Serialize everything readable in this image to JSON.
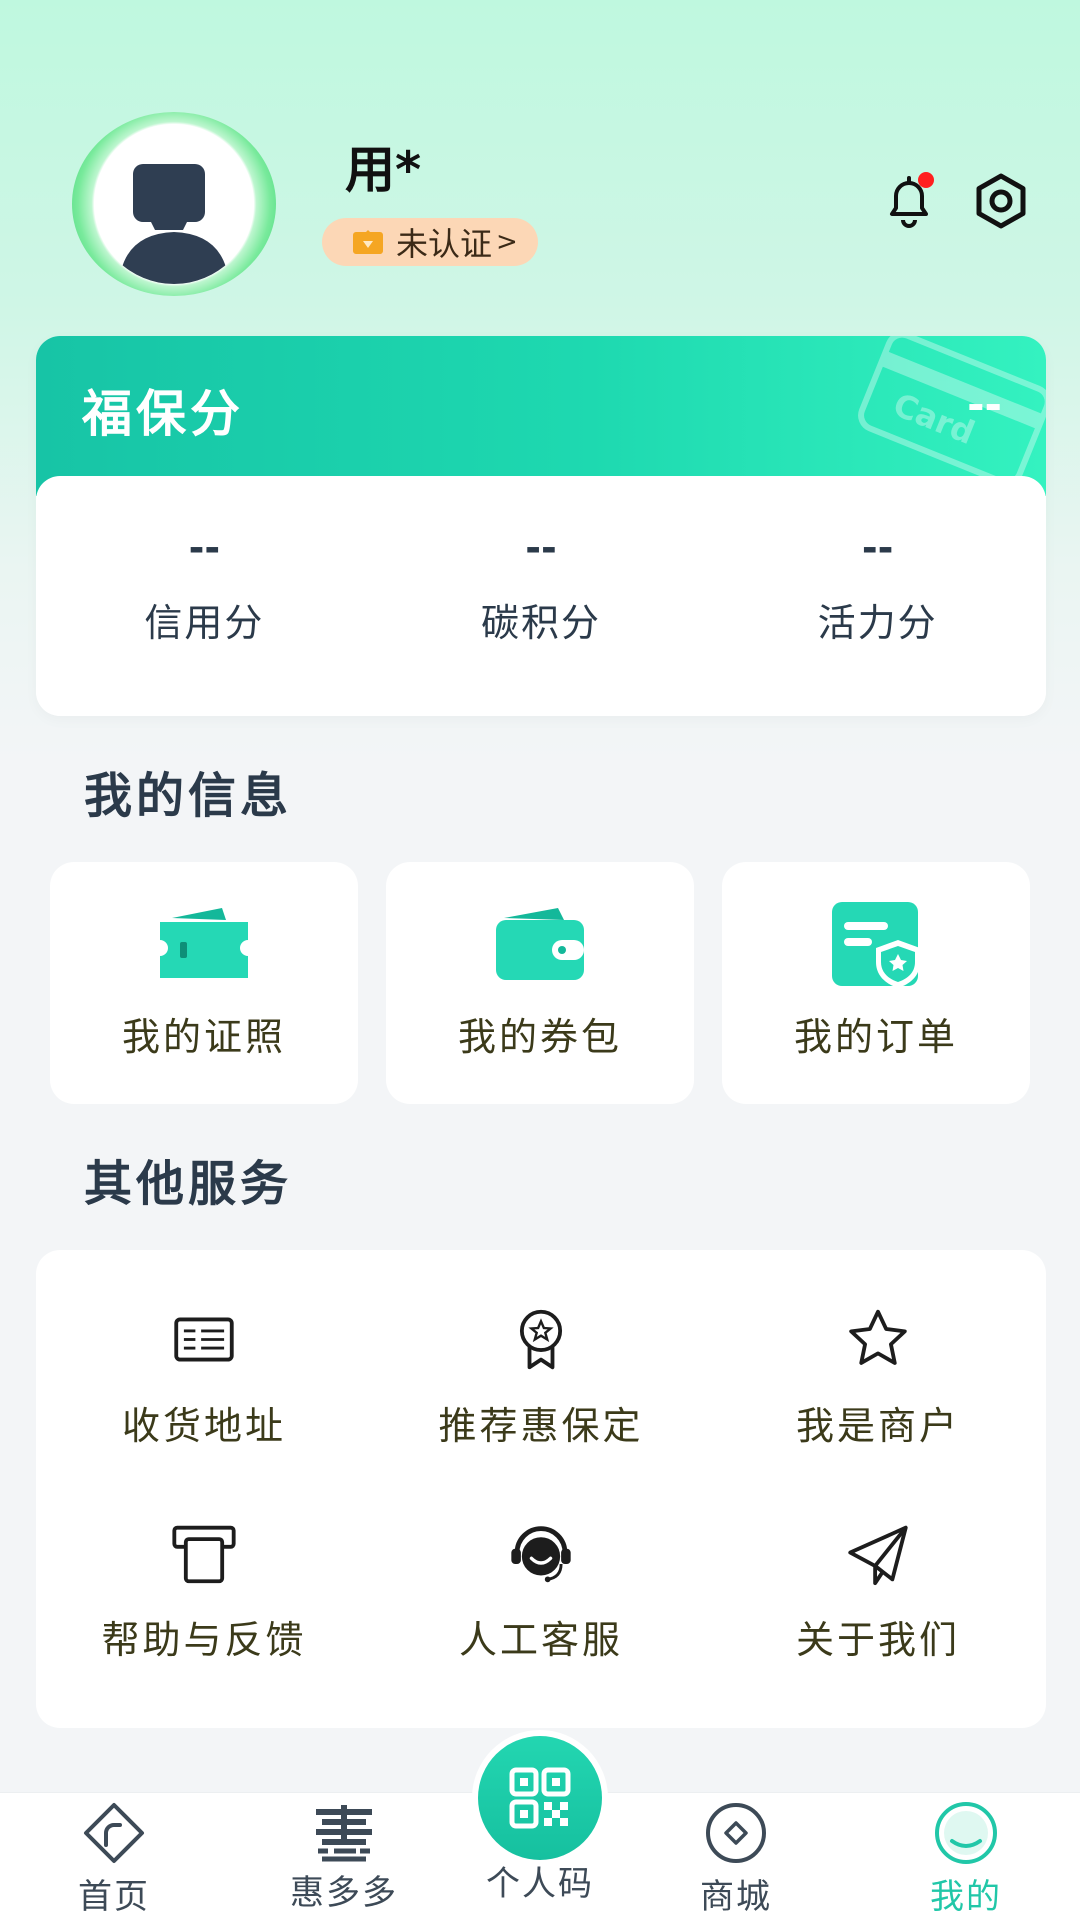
{
  "header": {
    "user_name": "用*",
    "verify_status": "未认证",
    "verify_arrow": ">",
    "notification_dot_color": "#ff1f1f"
  },
  "score_card": {
    "title": "福保分",
    "total": "--",
    "decoration_text": "Card",
    "items": [
      {
        "value": "--",
        "label": "信用分"
      },
      {
        "value": "--",
        "label": "碳积分"
      },
      {
        "value": "--",
        "label": "活力分"
      }
    ]
  },
  "my_info": {
    "title": "我的信息",
    "items": [
      {
        "label": "我的证照",
        "icon": "ticket-icon"
      },
      {
        "label": "我的券包",
        "icon": "wallet-icon"
      },
      {
        "label": "我的订单",
        "icon": "order-shield-icon"
      }
    ]
  },
  "other_services": {
    "title": "其他服务",
    "items": [
      {
        "label": "收货地址",
        "icon": "address-card-icon"
      },
      {
        "label": "推荐惠保定",
        "icon": "award-ribbon-icon"
      },
      {
        "label": "我是商户",
        "icon": "star-icon"
      },
      {
        "label": "帮助与反馈",
        "icon": "printer-feedback-icon"
      },
      {
        "label": "人工客服",
        "icon": "headset-icon"
      },
      {
        "label": "关于我们",
        "icon": "paper-plane-icon"
      }
    ]
  },
  "bottom_nav": {
    "items": [
      {
        "label": "首页",
        "icon": "home-diamond-icon"
      },
      {
        "label": "惠多多",
        "icon": "hui-logo-icon"
      },
      {
        "label": "个人码",
        "icon": "qr-code-icon"
      },
      {
        "label": "商城",
        "icon": "mall-icon"
      },
      {
        "label": "我的",
        "icon": "profile-icon"
      }
    ],
    "active": "我的"
  },
  "colors": {
    "accent": "#21c7a8",
    "header_gradient_start": "#bff8df",
    "badge_bg": "#fcd7b6"
  }
}
